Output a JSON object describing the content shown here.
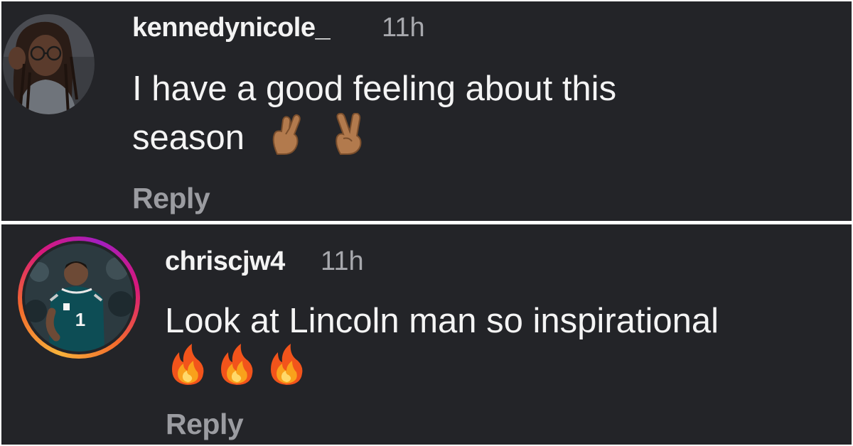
{
  "comments": [
    {
      "username": "kennedynicole_",
      "time": "11h",
      "text_line1": "I have a good feeling about this",
      "text_line2": "season",
      "emojis": [
        "crossed-fingers-icon",
        "victory-hand-icon"
      ],
      "reply_label": "Reply"
    },
    {
      "username": "chriscjw4",
      "time": "11h",
      "text_line1": "Look at Lincoln man so inspirational",
      "emojis": [
        "fire-icon",
        "fire-icon",
        "fire-icon"
      ],
      "reply_label": "Reply",
      "avatar_jersey_number": "1"
    }
  ],
  "colors": {
    "background": "#232428",
    "username": "#f3f3f3",
    "timestamp": "#a7a8ad",
    "reply": "#9b9ca1",
    "story_ring": [
      "#f7b23b",
      "#d8187a",
      "#a31ec0"
    ]
  }
}
